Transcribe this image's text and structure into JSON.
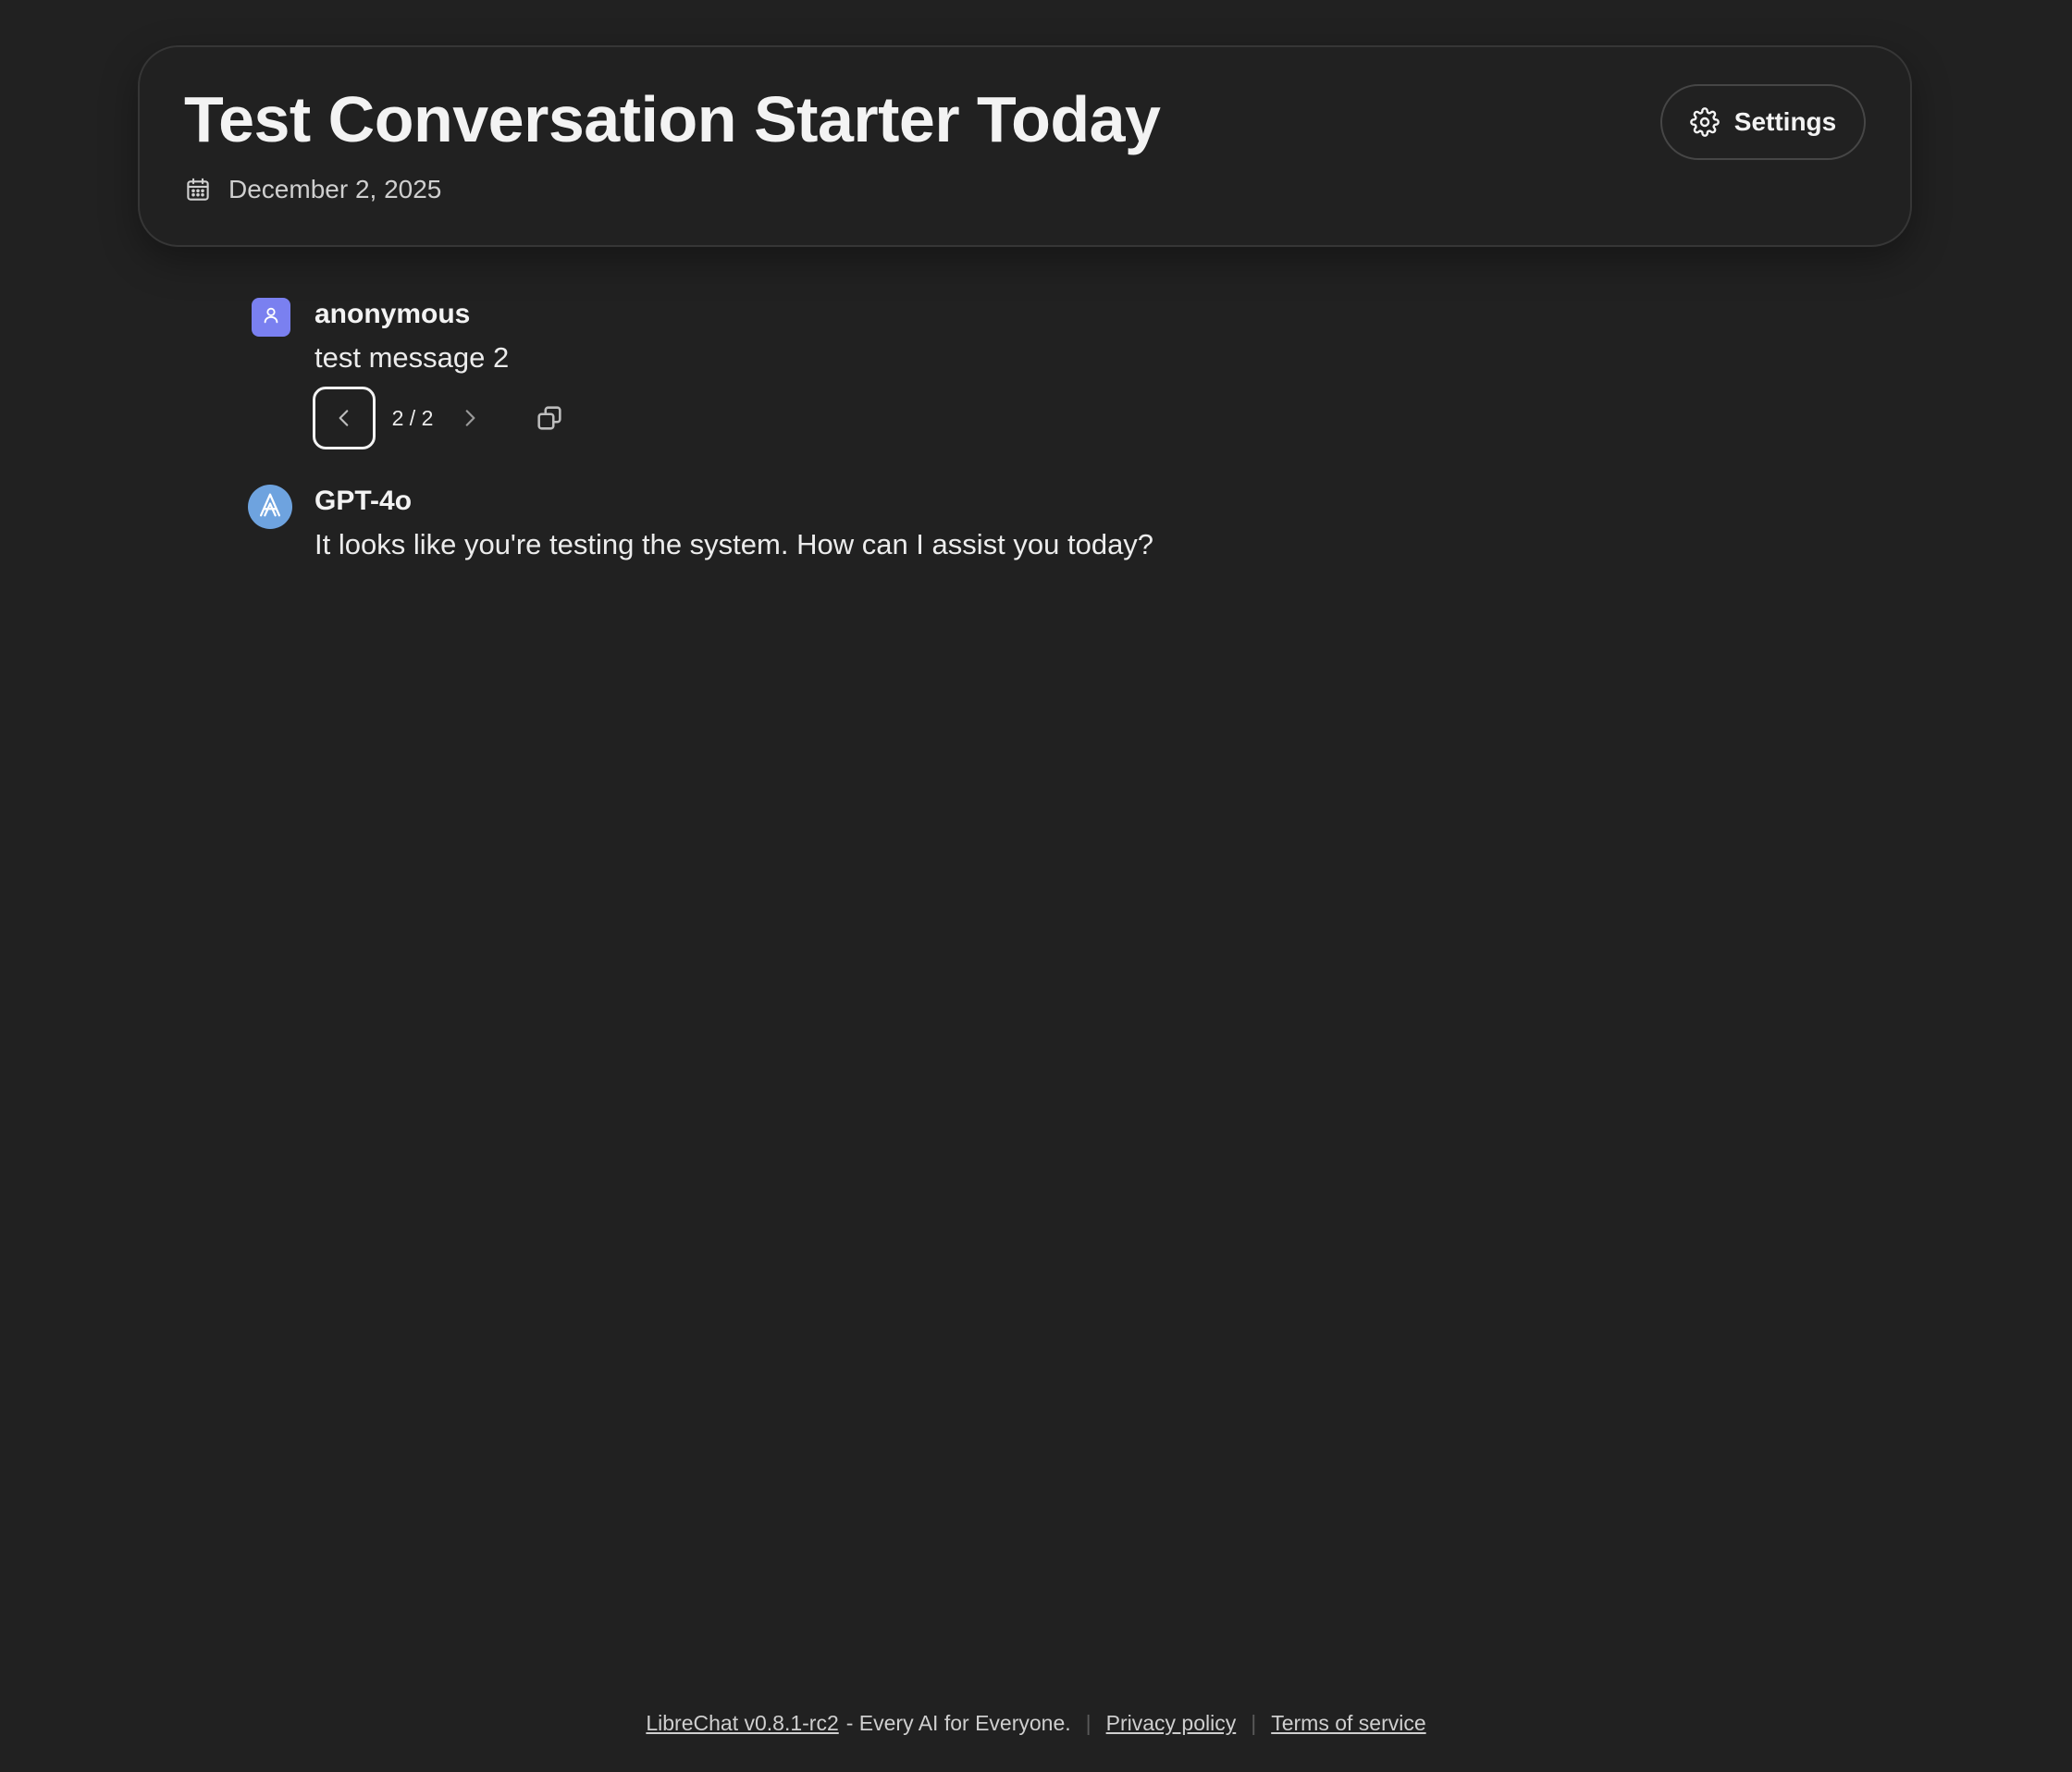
{
  "header": {
    "title": "Test Conversation Starter Today",
    "date": "December 2, 2025",
    "settings_label": "Settings"
  },
  "messages": [
    {
      "sender": "anonymous",
      "text": "test message 2",
      "avatar_icon": "user-icon",
      "avatar_color": "#7a80f0",
      "branch_counter": "2 / 2"
    },
    {
      "sender": "GPT-4o",
      "text": "It looks like you're testing the system. How can I assist you today?",
      "avatar_icon": "openai-logo-icon",
      "avatar_color": "#6ea3df"
    }
  ],
  "footer": {
    "version_link": "LibreChat v0.8.1-rc2",
    "tagline": "- Every AI for Everyone.",
    "privacy_link": "Privacy policy",
    "terms_link": "Terms of service"
  },
  "colors": {
    "background": "#212121",
    "text": "#ececec",
    "border": "#363636"
  }
}
